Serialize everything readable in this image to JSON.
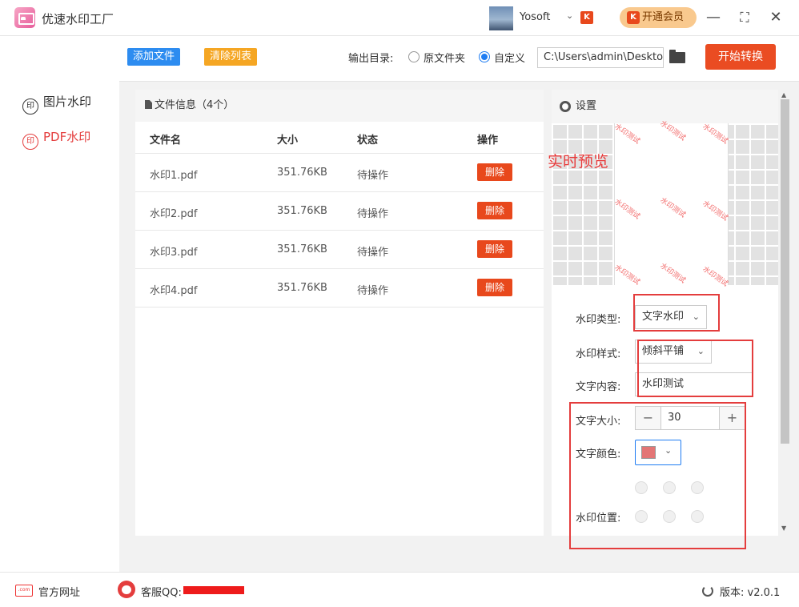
{
  "app": {
    "title": "优速水印工厂"
  },
  "user": {
    "name": "Yosoft"
  },
  "titlebar": {
    "vip_label": "开通会员",
    "minimize": "—",
    "maximize": "⛶",
    "close": "✕"
  },
  "sidebar": {
    "items": [
      {
        "label": "图片水印",
        "icon": "印",
        "active": false
      },
      {
        "label": "PDF水印",
        "icon": "印",
        "active": true
      }
    ]
  },
  "toolbar": {
    "add_file": "添加文件",
    "clear_list": "清除列表",
    "output_label": "输出目录:",
    "radio_original": "原文件夹",
    "radio_custom": "自定义",
    "path_value": "C:\\Users\\admin\\Deskto",
    "start": "开始转换"
  },
  "files": {
    "header": "文件信息（4个）",
    "columns": [
      "文件名",
      "大小",
      "状态",
      "操作"
    ],
    "rows": [
      {
        "name": "水印1.pdf",
        "size": "351.76KB",
        "status": "待操作",
        "action": "删除"
      },
      {
        "name": "水印2.pdf",
        "size": "351.76KB",
        "status": "待操作",
        "action": "删除"
      },
      {
        "name": "水印3.pdf",
        "size": "351.76KB",
        "status": "待操作",
        "action": "删除"
      },
      {
        "name": "水印4.pdf",
        "size": "351.76KB",
        "status": "待操作",
        "action": "删除"
      }
    ]
  },
  "settings": {
    "title": "设置",
    "preview_label": "实时预览",
    "watermark_sample": "水印测试",
    "type_label": "水印类型:",
    "type_value": "文字水印",
    "style_label": "水印样式:",
    "style_value": "倾斜平铺",
    "text_label": "文字内容:",
    "text_value": "水印测试",
    "size_label": "文字大小:",
    "size_value": "30",
    "minus": "−",
    "plus": "+",
    "color_label": "文字颜色:",
    "color_value": "#e37575",
    "position_label": "水印位置:"
  },
  "footer": {
    "site_label": "官方网址",
    "site_icon_text": ".com",
    "support_label": "客服QQ:",
    "version_label": "版本: v2.0.1"
  },
  "colors": {
    "accent_blue": "#2d8cf0",
    "accent_orange": "#ea4c22",
    "clear_button": "#f5a623"
  }
}
